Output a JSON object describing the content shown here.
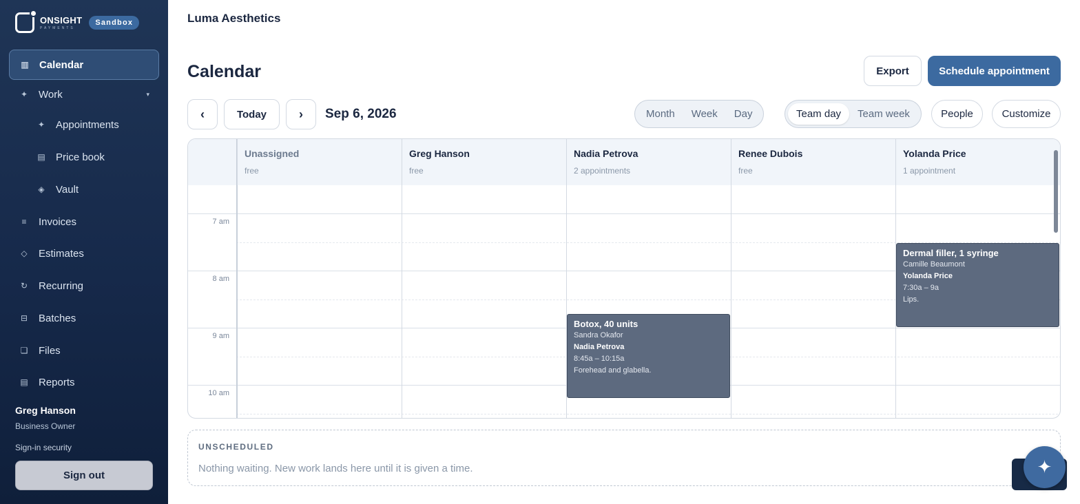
{
  "brand": {
    "name": "ONSIGHT",
    "sub": "PAYMENTS",
    "env_badge": "Sandbox"
  },
  "sidebar": {
    "items": [
      {
        "label": "Calendar",
        "icon": "calendar-icon",
        "glyph": "▥"
      },
      {
        "label": "Work",
        "icon": "sparkle-icon",
        "glyph": "✦",
        "caret": "▾"
      },
      {
        "label": "Appointments",
        "icon": "sparkle-icon",
        "glyph": "✦"
      },
      {
        "label": "Price book",
        "icon": "book-icon",
        "glyph": "▤"
      },
      {
        "label": "Vault",
        "icon": "diamond-icon",
        "glyph": "◈"
      },
      {
        "label": "Invoices",
        "icon": "list-icon",
        "glyph": "≡"
      },
      {
        "label": "Estimates",
        "icon": "diamond-outline-icon",
        "glyph": "◇"
      },
      {
        "label": "Recurring",
        "icon": "refresh-icon",
        "glyph": "↻"
      },
      {
        "label": "Batches",
        "icon": "batch-icon",
        "glyph": "⊟"
      },
      {
        "label": "Files",
        "icon": "file-icon",
        "glyph": "❏"
      },
      {
        "label": "Reports",
        "icon": "report-icon",
        "glyph": "▤"
      }
    ],
    "user": {
      "name": "Greg Hanson",
      "role": "Business Owner"
    },
    "signin_security": "Sign-in security",
    "signout": "Sign out"
  },
  "header": {
    "business": "Luma Aesthetics"
  },
  "page": {
    "title": "Calendar"
  },
  "actions": {
    "export": "Export",
    "schedule": "Schedule appointment"
  },
  "toolbar": {
    "prev": "‹",
    "today": "Today",
    "next": "›",
    "date": "Sep 6, 2026",
    "views": [
      "Month",
      "Week",
      "Day"
    ],
    "team_views": [
      "Team day",
      "Team week"
    ],
    "team_selected": "Team day",
    "people": "People",
    "customize": "Customize"
  },
  "columns": [
    {
      "name": "Unassigned",
      "sub": "free"
    },
    {
      "name": "Greg Hanson",
      "sub": "free"
    },
    {
      "name": "Nadia Petrova",
      "sub": "2 appointments"
    },
    {
      "name": "Renee Dubois",
      "sub": "free"
    },
    {
      "name": "Yolanda Price",
      "sub": "1 appointment"
    }
  ],
  "time_labels": [
    "7 am",
    "8 am",
    "9 am",
    "10 am"
  ],
  "appointments": [
    {
      "title": "Botox, 40 units",
      "client": "Sandra Okafor",
      "staff": "Nadia Petrova",
      "time": "8:45a – 10:15a",
      "note": "Forehead and glabella."
    },
    {
      "title": "Dermal filler, 1 syringe",
      "client": "Camille Beaumont",
      "staff": "Yolanda Price",
      "time": "7:30a – 9a",
      "note": "Lips."
    }
  ],
  "unscheduled": {
    "title": "UNSCHEDULED",
    "message": "Nothing waiting. New work lands here until it is given a time."
  },
  "fab": {
    "icon": "sparkle-icon",
    "glyph": "✦"
  }
}
